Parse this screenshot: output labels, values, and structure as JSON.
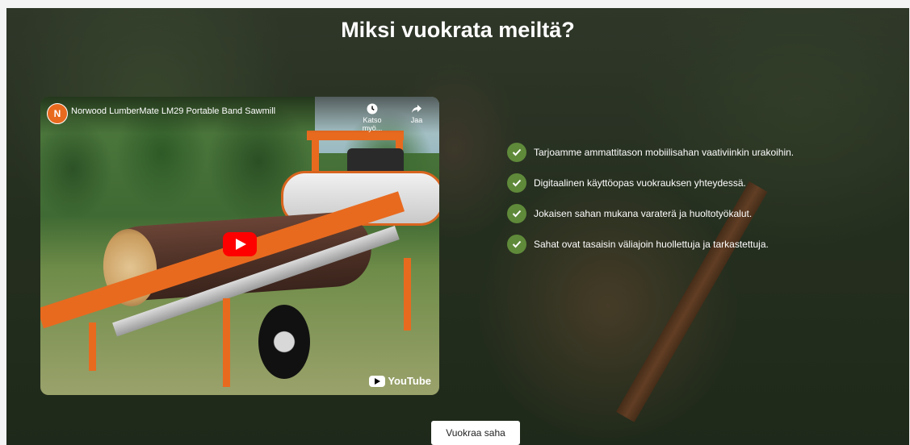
{
  "section": {
    "title": "Miksi vuokrata meiltä?"
  },
  "video": {
    "channel_logo_letter": "N",
    "title": "Norwood LumberMate LM29 Portable Band Sawmill",
    "watch_later_label": "Katso myö...",
    "share_label": "Jaa",
    "youtube_label": "YouTube",
    "colors": {
      "play_button": "#ff0000",
      "brand_orange": "#e86a1f"
    }
  },
  "features": [
    {
      "text": "Tarjoamme ammattitason mobiilisahan vaativiinkin urakoihin.",
      "icon": "check-icon"
    },
    {
      "text": "Digitaalinen käyttöopas vuokrauksen yhteydessä.",
      "icon": "check-icon"
    },
    {
      "text": "Jokaisen sahan mukana varaterä ja huoltotyökalut.",
      "icon": "check-icon"
    },
    {
      "text": "Sahat ovat tasaisin väliajoin huollettuja ja tarkastettuja.",
      "icon": "check-icon"
    }
  ],
  "cta": {
    "label": "Vuokraa saha"
  },
  "colors": {
    "check_green": "#5f8a3a",
    "title_text": "#ffffff"
  }
}
